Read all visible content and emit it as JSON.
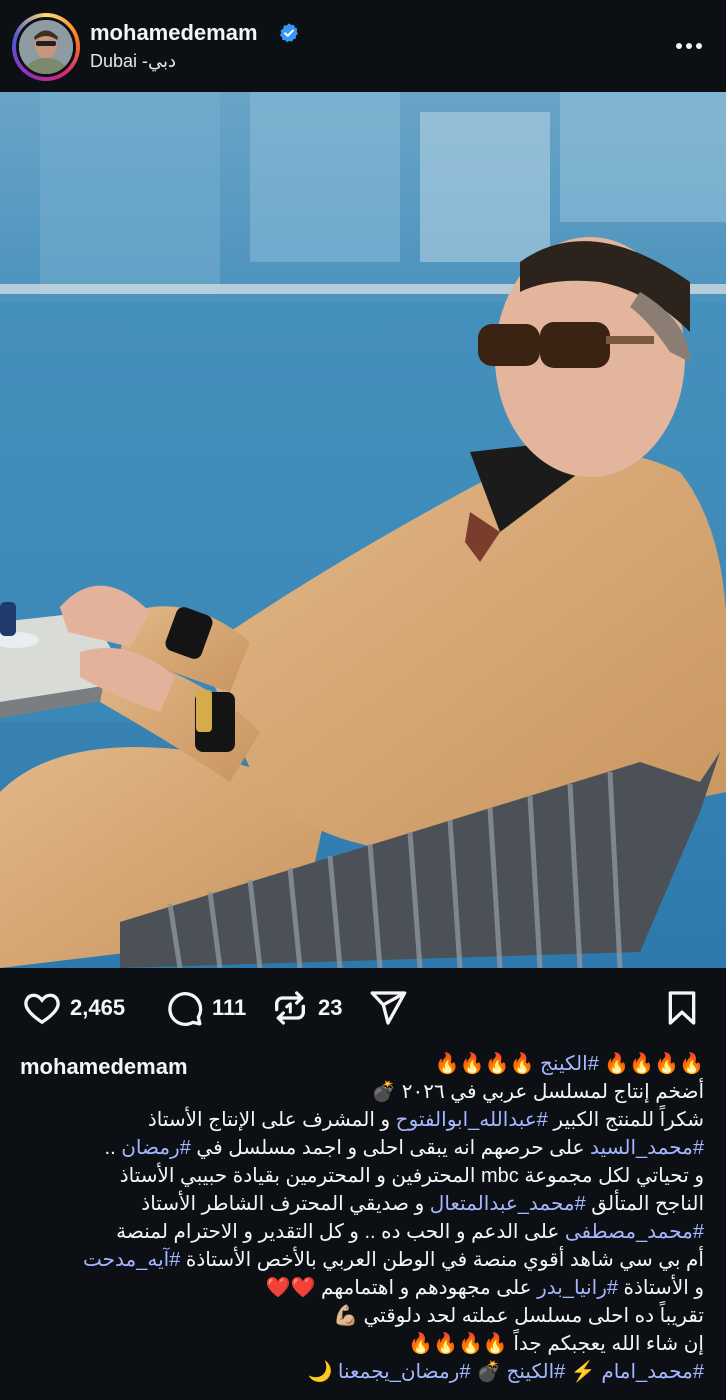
{
  "post": {
    "username": "mohamedemam",
    "location": "Dubai -دبي",
    "verified": true
  },
  "actions": {
    "likes": "2,465",
    "comments": "111",
    "reposts": "23"
  },
  "caption": {
    "username": "mohamedemam",
    "lines": [
      [
        {
          "t": "🔥🔥🔥🔥 ",
          "tag": false
        },
        {
          "t": "#الكينج",
          "tag": true
        },
        {
          "t": " 🔥🔥🔥🔥",
          "tag": false
        }
      ],
      [
        {
          "t": "أضخم إنتاج لمسلسل عربي في ٢٠٢٦ 💣",
          "tag": false
        }
      ],
      [
        {
          "t": "شكراً للمنتج الكبير ",
          "tag": false
        },
        {
          "t": "#عبدالله_ابوالفتوح",
          "tag": true
        },
        {
          "t": " و المشرف على الإنتاج الأستاذ",
          "tag": false
        }
      ],
      [
        {
          "t": "#محمد_السيد",
          "tag": true
        },
        {
          "t": " على حرصهم انه يبقى احلى و اجمد مسلسل في ",
          "tag": false
        },
        {
          "t": "#رمضان",
          "tag": true
        },
        {
          "t": " ..",
          "tag": false
        }
      ],
      [
        {
          "t": "و تحياتي لكل مجموعة mbc المحترفين و المحترمين بقيادة حبيبي الأستاذ",
          "tag": false
        }
      ],
      [
        {
          "t": "الناجح المتألق ",
          "tag": false
        },
        {
          "t": "#محمد_عبدالمتعال",
          "tag": true
        },
        {
          "t": " و صديقي المحترف الشاطر الأستاذ",
          "tag": false
        }
      ],
      [
        {
          "t": "#محمد_مصطفى",
          "tag": true
        },
        {
          "t": " على الدعم و الحب ده .. و كل التقدير و الاحترام لمنصة",
          "tag": false
        }
      ],
      [
        {
          "t": "أم بي سي شاهد أقوي منصة في الوطن العربي بالأخص الأستاذة ",
          "tag": false
        },
        {
          "t": "#آيه_مدحت",
          "tag": true
        }
      ],
      [
        {
          "t": "و الأستاذة ",
          "tag": false
        },
        {
          "t": "#رانيا_بدر",
          "tag": true
        },
        {
          "t": " على مجهودهم و اهتمامهم ❤️❤️",
          "tag": false
        }
      ],
      [
        {
          "t": "تقريباً ده احلى مسلسل عملته لحد دلوقتي 💪🏼",
          "tag": false
        }
      ],
      [
        {
          "t": "إن شاء الله يعجبكم جداً 🔥🔥🔥🔥",
          "tag": false
        }
      ],
      [
        {
          "t": "#محمد_امام",
          "tag": true
        },
        {
          "t": " ⚡️ ",
          "tag": false
        },
        {
          "t": "#الكينج",
          "tag": true
        },
        {
          "t": " 💣 ",
          "tag": false
        },
        {
          "t": "#رمضان_يجمعنا",
          "tag": true
        },
        {
          "t": " 🌙",
          "tag": false
        }
      ]
    ]
  },
  "colors": {
    "background": "#0c1014",
    "text": "#f5f5f5",
    "hashtag": "#a4b7ff",
    "verified": "#3897f0"
  },
  "icons": {
    "verified": "verified-badge-icon",
    "more": "more-options-icon",
    "like": "heart-icon",
    "comment": "comment-bubble-icon",
    "repost": "repost-icon",
    "share": "send-icon",
    "save": "bookmark-icon"
  }
}
